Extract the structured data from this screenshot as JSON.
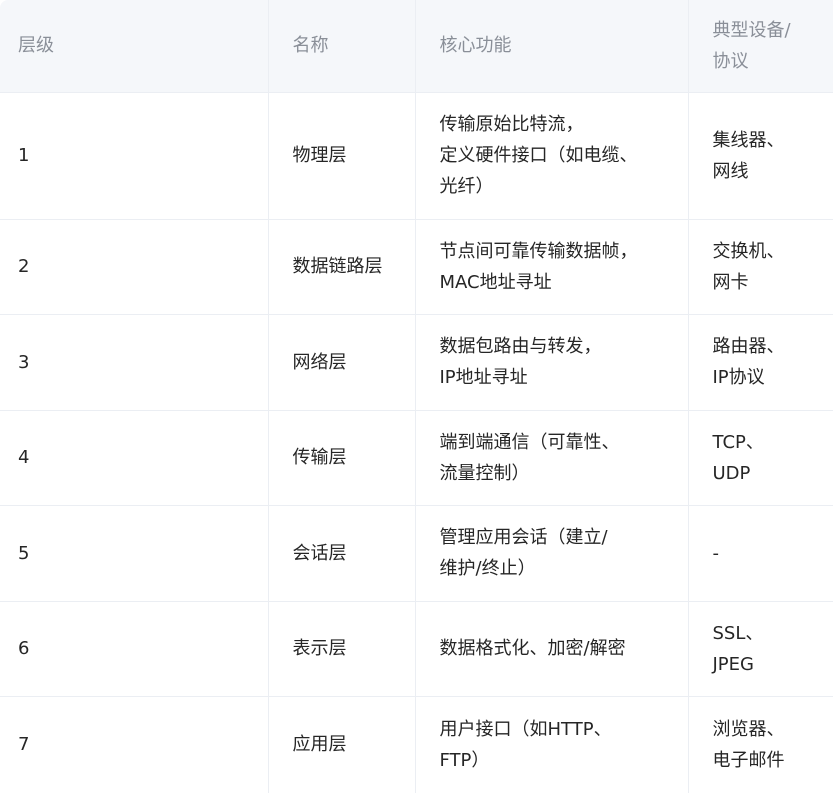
{
  "table": {
    "headers": [
      "层级",
      "名称",
      "核心功能",
      "典型设备/\n协议"
    ],
    "rows": [
      {
        "level": "1",
        "name": "物理层",
        "function": "传输原始比特流，\n定义硬件接口（如电缆、\n光纤）",
        "devices": "集线器、\n网线"
      },
      {
        "level": "2",
        "name": "数据链路层",
        "function": "节点间可靠传输数据帧，\nMAC地址寻址",
        "devices": "交换机、\n网卡"
      },
      {
        "level": "3",
        "name": "网络层",
        "function": "数据包路由与转发，\nIP地址寻址",
        "devices": "路由器、\nIP协议"
      },
      {
        "level": "4",
        "name": "传输层",
        "function": "端到端通信（可靠性、\n流量控制）",
        "devices": "TCP、\nUDP"
      },
      {
        "level": "5",
        "name": "会话层",
        "function": "管理应用会话（建立/\n维护/终止）",
        "devices": "-"
      },
      {
        "level": "6",
        "name": "表示层",
        "function": "数据格式化、加密/解密",
        "devices": "SSL、\nJPEG"
      },
      {
        "level": "7",
        "name": "应用层",
        "function": "用户接口（如HTTP、\nFTP）",
        "devices": "浏览器、\n电子邮件"
      }
    ]
  }
}
